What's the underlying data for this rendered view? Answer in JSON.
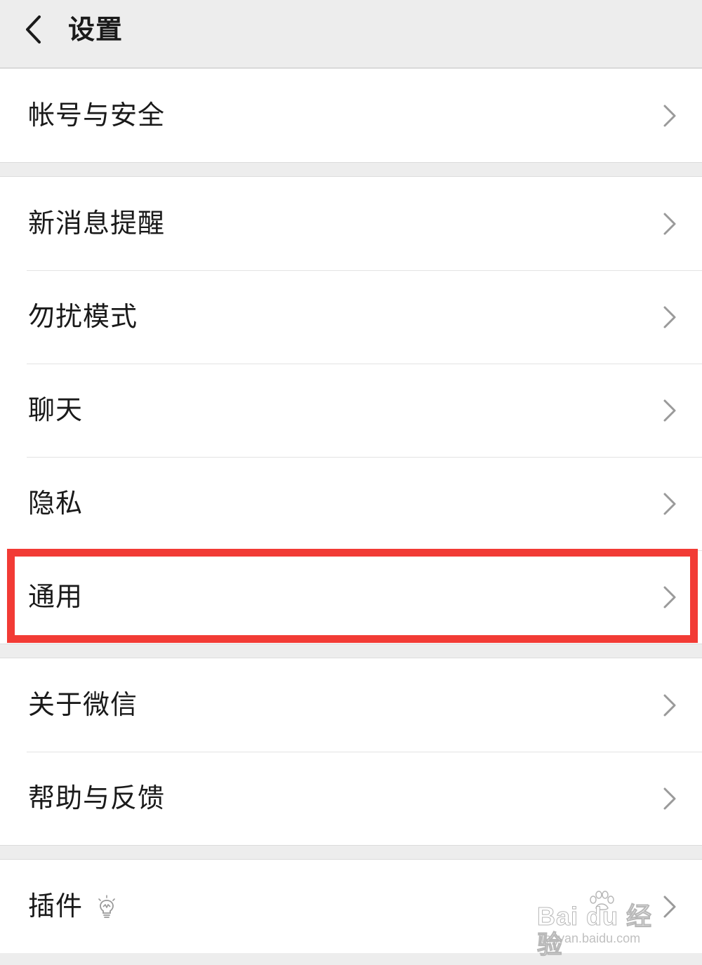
{
  "header": {
    "title": "设置",
    "back_icon": "chevron-left-icon"
  },
  "groups": [
    {
      "items": [
        {
          "label": "帐号与安全"
        }
      ]
    },
    {
      "items": [
        {
          "label": "新消息提醒"
        },
        {
          "label": "勿扰模式"
        },
        {
          "label": "聊天"
        },
        {
          "label": "隐私"
        },
        {
          "label": "通用",
          "highlighted": true
        }
      ]
    },
    {
      "items": [
        {
          "label": "关于微信"
        },
        {
          "label": "帮助与反馈"
        }
      ]
    },
    {
      "items": [
        {
          "label": "插件",
          "icon": "lightbulb-icon"
        }
      ]
    }
  ],
  "highlight_color": "#f23b35",
  "watermark": {
    "main": "Bai du 经验",
    "sub": "jingyan.baidu.com"
  }
}
